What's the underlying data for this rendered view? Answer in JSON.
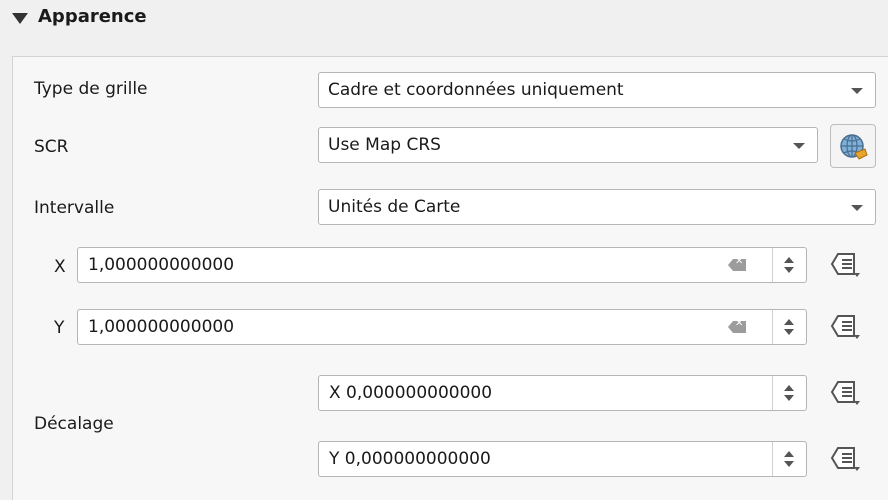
{
  "section": {
    "title": "Apparence"
  },
  "rows": {
    "grid_type": {
      "label": "Type de grille",
      "value": "Cadre et coordonnées uniquement"
    },
    "crs": {
      "label": "SCR",
      "value": "Use Map CRS"
    },
    "interval": {
      "label": "Intervalle",
      "value": "Unités de Carte"
    },
    "x": {
      "label": "X",
      "value": "1,000000000000"
    },
    "y": {
      "label": "Y",
      "value": "1,000000000000"
    },
    "offset": {
      "label": "Décalage",
      "x_value": "X 0,000000000000",
      "y_value": "Y 0,000000000000"
    }
  },
  "icons": {
    "collapse": "triangle-down-icon",
    "crs_select": "globe-icon",
    "clear": "backspace-clear-icon",
    "data_defined": "data-defined-override-icon"
  }
}
